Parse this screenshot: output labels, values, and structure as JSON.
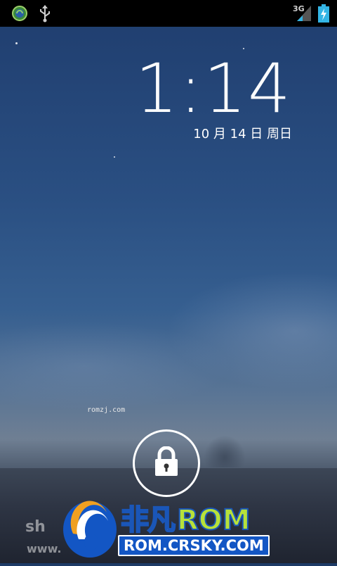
{
  "status_bar": {
    "icons": [
      "sync-globe-icon",
      "usb-icon",
      "signal-icon",
      "battery-charging-icon"
    ],
    "network_type": "3G"
  },
  "lockscreen": {
    "time": "1:14",
    "date": "10 月 14 日 周日",
    "unlock_icon": "lock-icon"
  },
  "watermarks": {
    "small": "romzj.com",
    "fragment_top": "sh",
    "fragment_bottom": "www."
  },
  "brand": {
    "cn_name": "非凡",
    "rom_word": "ROM",
    "url": "ROM.CRSKY.COM",
    "colors": {
      "blue": "#1356c4",
      "green": "#b7e13a",
      "orange": "#f0a020"
    }
  }
}
